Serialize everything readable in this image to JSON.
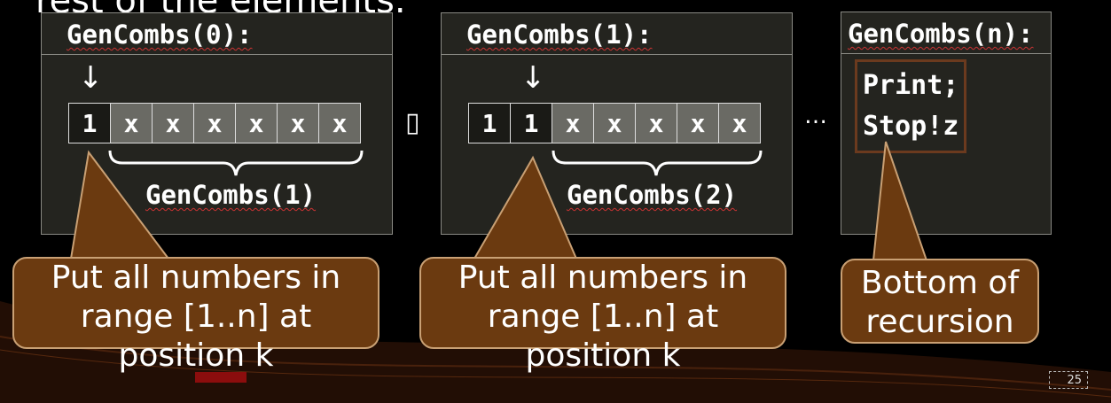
{
  "slide": {
    "top_text": "rest of the elements.",
    "page_number": "25",
    "colors": {
      "background": "#000000",
      "panel": "#24241f",
      "callout": "#6b3a10",
      "callout_border": "#c9a074",
      "base_box_border": "#6b3a1e"
    }
  },
  "panels": [
    {
      "title": "GenCombs(0):",
      "cells": [
        "1",
        "x",
        "x",
        "x",
        "x",
        "x",
        "x"
      ],
      "fixed_count": 1,
      "brace_label": "GenCombs(1)",
      "callout": [
        "Put all numbers in",
        "range [1..n] at",
        "position k"
      ]
    },
    {
      "title": "GenCombs(1):",
      "cells": [
        "1",
        "1",
        "x",
        "x",
        "x",
        "x",
        "x"
      ],
      "fixed_count": 2,
      "brace_label": "GenCombs(2)",
      "callout": [
        "Put all numbers in",
        "range [1..n] at",
        "position k"
      ]
    },
    {
      "title": "GenCombs(n):",
      "base_lines": [
        "Print;",
        "Stop!z"
      ],
      "callout": [
        "Bottom of",
        "recursion"
      ]
    }
  ],
  "separators": {
    "first": "▯",
    "second": "…"
  },
  "icons": {
    "arrow": "down-arrow-icon"
  }
}
